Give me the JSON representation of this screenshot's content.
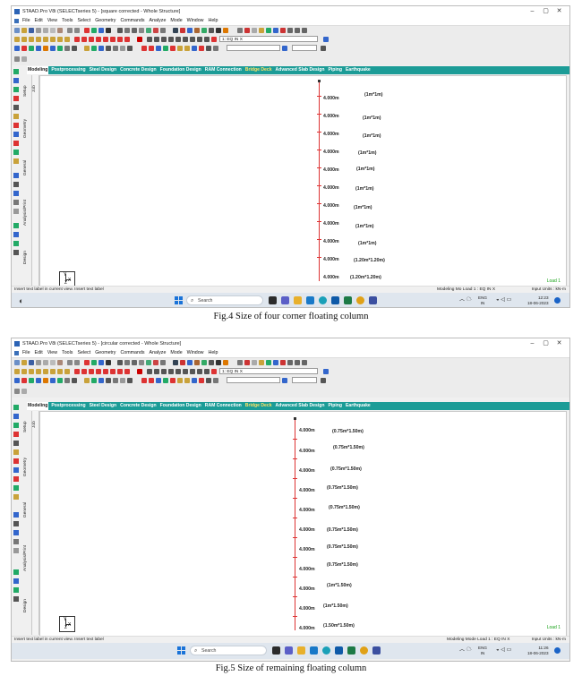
{
  "screens": [
    {
      "title": "STAAD.Pro V8i (SELECTseries 5) - [square corrected - Whole Structure]",
      "menu": [
        "File",
        "Edit",
        "View",
        "Tools",
        "Select",
        "Geometry",
        "Commands",
        "Analyze",
        "Mode",
        "Window",
        "Help"
      ],
      "load_combo": "1: EQ IN X",
      "tabs": [
        "Modeling",
        "Postprocessing",
        "Steel Design",
        "Concrete Design",
        "Foundation Design",
        "RAM Connection",
        "Bridge Deck",
        "Advanced Slab Design",
        "Piping",
        "Earthquake"
      ],
      "side_tabs": [
        "Setup",
        "Geometry",
        "General",
        "Analysis/Print",
        "Design"
      ],
      "job_tab": "Job",
      "heights": [
        "4.000m",
        "4.000m",
        "4.000m",
        "4.000m",
        "4.000m",
        "4.000m",
        "4.000m",
        "4.000m",
        "4.000m",
        "4.000m",
        "4.000m"
      ],
      "sizes": [
        "(1m*1m)",
        "(1m*1m)",
        "(1m*1m)",
        "(1m*1m)",
        "(1m*1m)",
        "(1m*1m)",
        "(1m*1m)",
        "(1m*1m)",
        "(1m*1m)",
        "(1.20m*1.20m)",
        "(1.20m*1.20m)"
      ],
      "axis": {
        "x": "X",
        "y": "Y",
        "z": "Z"
      },
      "load_label": "Load 1",
      "status_left": "Insert text label in current view. Insert text label",
      "status_mid": "Modeling Mo Load 1 : EQ IN X",
      "status_right": "Input Units : kN-m",
      "search_placeholder": "Search",
      "tray_lang": "ENG",
      "tray_region": "IN",
      "tray_time": "12:23",
      "tray_date": "18-06-2023"
    },
    {
      "title": "STAAD.Pro V8i (SELECTseries 5) - [circular corrected - Whole Structure]",
      "menu": [
        "File",
        "Edit",
        "View",
        "Tools",
        "Select",
        "Geometry",
        "Commands",
        "Analyze",
        "Mode",
        "Window",
        "Help"
      ],
      "load_combo": "1: EQ IN X",
      "tabs": [
        "Modeling",
        "Postprocessing",
        "Steel Design",
        "Concrete Design",
        "Foundation Design",
        "RAM Connection",
        "Bridge Deck",
        "Advanced Slab Design",
        "Piping",
        "Earthquake"
      ],
      "side_tabs": [
        "Setup",
        "Geometry",
        "General",
        "Analysis/Print",
        "Design"
      ],
      "job_tab": "Job",
      "heights": [
        "4.000m",
        "4.000m",
        "4.000m",
        "4.000m",
        "4.000m",
        "4.000m",
        "4.000m",
        "4.000m",
        "4.000m",
        "4.000m",
        "4.000m"
      ],
      "sizes": [
        "(0.75m*1.50m)",
        "(0.75m*1.50m)",
        "(0.75m*1.50m)",
        "(0.75m*1.50m)",
        "(0.75m*1.50m)",
        "(0.75m*1.50m)",
        "(0.75m*1.50m)",
        "(0.75m*1.50m)",
        "(1m*1.50m)",
        "(1m*1.50m)",
        "(1.50m*1.50m)"
      ],
      "axis": {
        "x": "X",
        "y": "Y",
        "z": "Z"
      },
      "load_label": "Load 1",
      "status_left": "Insert text label in current view. Insert text label",
      "status_mid": "Modeling Mode Load 1 : EQ IN X",
      "status_right": "Input Units : kN-m",
      "search_placeholder": "Search",
      "tray_lang": "ENG",
      "tray_region": "IN",
      "tray_time": "11:26",
      "tray_date": "18-06-2023"
    }
  ],
  "captions": [
    "Fig.4 Size of four corner floating column",
    "Fig.5 Size of remaining floating column"
  ],
  "colors": {
    "tab_bar": "#1c9c97",
    "column_line": "#dd3333",
    "load_label": "#1aa31a",
    "accent_tab": "#ffe266"
  }
}
